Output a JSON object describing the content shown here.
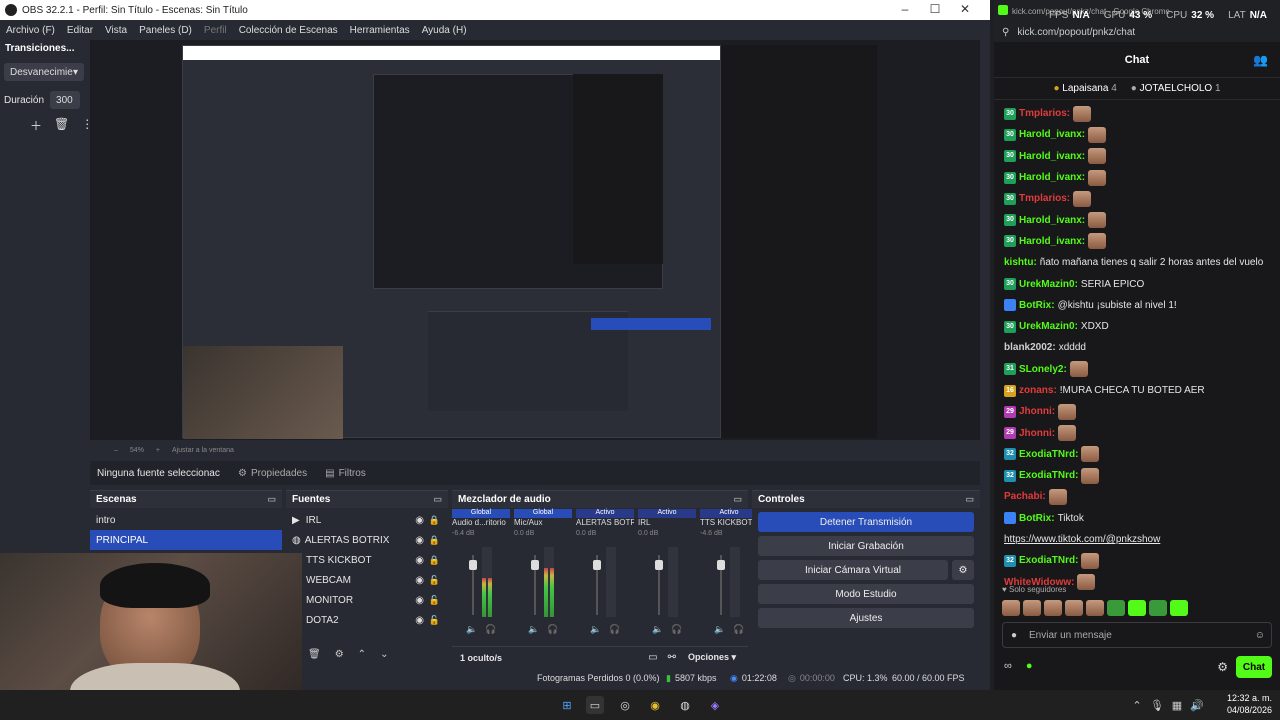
{
  "obs": {
    "title": "OBS 32.2.1 - Perfil: Sin Título - Escenas: Sin Título",
    "menu": [
      "Archivo (F)",
      "Editar",
      "Vista",
      "Paneles (D)",
      "Perfil",
      "Colección de Escenas",
      "Herramientas",
      "Ayuda (H)"
    ],
    "transitions": {
      "title": "Transiciones...",
      "type": "Desvanecimie",
      "duration_label": "Duración",
      "duration_value": "300"
    },
    "zoom": "54%",
    "fit_label": "Ajustar a la ventana",
    "source_selected": "Ninguna fuente seleccionac",
    "properties_label": "Propiedades",
    "filters_label": "Filtros",
    "scenes": {
      "title": "Escenas",
      "items": [
        "intro",
        "PRINCIPAL"
      ],
      "selected": "PRINCIPAL"
    },
    "sources": {
      "title": "Fuentes",
      "items": [
        "IRL",
        "ALERTAS BOTRIX",
        "TTS KICKBOT",
        "WEBCAM",
        "MONITOR",
        "DOTA2"
      ]
    },
    "mixer": {
      "title": "Mezclador de audio",
      "channels": [
        {
          "badge": "Global",
          "name": "Audio d...ritorio",
          "db": "-6.4 dB",
          "level": 0.55
        },
        {
          "badge": "Global",
          "name": "Mic/Aux",
          "db": "0.0 dB",
          "level": 0.7
        },
        {
          "badge": "Activo",
          "name": "ALERTAS BOTRIX",
          "db": "0.0 dB",
          "level": 0
        },
        {
          "badge": "Activo",
          "name": "IRL",
          "db": "0.0 dB",
          "level": 0
        },
        {
          "badge": "Activo",
          "name": "TTS KICKBOT",
          "db": "-4.6 dB",
          "level": 0
        }
      ],
      "scale": [
        "0",
        "-5",
        "-10",
        "-15",
        "-20",
        "-25",
        "-30",
        "-35",
        "-40",
        "-45",
        "-50",
        "-54"
      ],
      "hidden": "1 oculto/s",
      "options_label": "Opciones"
    },
    "controls": {
      "title": "Controles",
      "buttons": [
        "Detener Transmisión",
        "Iniciar Grabación",
        "Iniciar Cámara Virtual",
        "Modo Estudio",
        "Ajustes"
      ]
    },
    "status": {
      "dropped": "Fotogramas Perdidos 0 (0.0%)",
      "bitrate": "5807 kbps",
      "live_time": "01:22:08",
      "rec_time": "00:00:00",
      "cpu": "CPU: 1.3%",
      "fps": "60.00 / 60.00 FPS"
    }
  },
  "chrome": {
    "title": "kick.com/popout/pnkz/chat - Google Chrome",
    "url": "kick.com/popout/pnkz/chat",
    "perf": {
      "fps_label": "FPS",
      "fps": "N/A",
      "gpu_label": "GPU",
      "gpu": "43 %",
      "cpu_label": "CPU",
      "cpu": "32 %",
      "lat_label": "LAT",
      "lat": "N/A"
    },
    "chat_title": "Chat",
    "leaderboard": [
      {
        "name": "Lapaisana",
        "count": "4"
      },
      {
        "name": "JOTAELCHOLO",
        "count": "1"
      }
    ],
    "messages": [
      {
        "badge": "30",
        "badge_color": "#1fa05a",
        "user": "Tmplarios:",
        "color": "#e23b3b",
        "text": "",
        "emote": true
      },
      {
        "badge": "30",
        "badge_color": "#1fa05a",
        "user": "Harold_ivanx:",
        "color": "#53fc18",
        "text": "",
        "emote": true
      },
      {
        "badge": "30",
        "badge_color": "#1fa05a",
        "user": "Harold_ivanx:",
        "color": "#53fc18",
        "text": "",
        "emote": true
      },
      {
        "badge": "30",
        "badge_color": "#1fa05a",
        "user": "Harold_ivanx:",
        "color": "#53fc18",
        "text": "",
        "emote": true
      },
      {
        "badge": "30",
        "badge_color": "#1fa05a",
        "user": "Tmplarios:",
        "color": "#e23b3b",
        "text": "",
        "emote": true
      },
      {
        "badge": "30",
        "badge_color": "#1fa05a",
        "user": "Harold_ivanx:",
        "color": "#53fc18",
        "text": "",
        "emote": true
      },
      {
        "badge": "30",
        "badge_color": "#1fa05a",
        "user": "Harold_ivanx:",
        "color": "#53fc18",
        "text": "",
        "emote": true
      },
      {
        "badge": "",
        "badge_color": "",
        "user": "kishtu:",
        "color": "#53fc18",
        "text": "ñato mañana tienes q salir 2 horas antes del vuelo",
        "emote": false
      },
      {
        "badge": "30",
        "badge_color": "#1fa05a",
        "user": "UrekMazin0:",
        "color": "#53fc18",
        "text": "SERIA EPICO",
        "emote": false
      },
      {
        "badge": "",
        "badge_color": "#3b82f6",
        "user": "BotRix:",
        "color": "#53fc18",
        "text": "@kishtu ¡subiste al nivel 1!",
        "emote": false
      },
      {
        "badge": "30",
        "badge_color": "#1fa05a",
        "user": "UrekMazin0:",
        "color": "#53fc18",
        "text": "XDXD",
        "emote": false
      },
      {
        "badge": "",
        "badge_color": "",
        "user": "blank2002:",
        "color": "#cfcfcf",
        "text": "xdddd",
        "emote": false
      },
      {
        "badge": "31",
        "badge_color": "#1fa05a",
        "user": "SLonely2:",
        "color": "#53fc18",
        "text": "",
        "emote": true
      },
      {
        "badge": "16",
        "badge_color": "#d6a21f",
        "user": "zonans:",
        "color": "#e23b3b",
        "text": "!MURA CHECA TU BOTED AER",
        "emote": false
      },
      {
        "badge": "29",
        "badge_color": "#b13bb1",
        "user": "Jhonni:",
        "color": "#e23b3b",
        "text": "",
        "emote": true
      },
      {
        "badge": "29",
        "badge_color": "#b13bb1",
        "user": "Jhonni:",
        "color": "#e23b3b",
        "text": "",
        "emote": true
      },
      {
        "badge": "32",
        "badge_color": "#1f8fb0",
        "user": "ExodiaTNrd:",
        "color": "#53fc18",
        "text": "",
        "emote": true
      },
      {
        "badge": "32",
        "badge_color": "#1f8fb0",
        "user": "ExodiaTNrd:",
        "color": "#53fc18",
        "text": "",
        "emote": true
      },
      {
        "badge": "",
        "badge_color": "",
        "user": "Pachabi:",
        "color": "#e23b3b",
        "text": "",
        "emote": true
      },
      {
        "badge": "",
        "badge_color": "#3b82f6",
        "user": "BotRix:",
        "color": "#53fc18",
        "text": "Tiktok",
        "emote": false
      },
      {
        "badge": "",
        "badge_color": "",
        "user": "",
        "color": "#cfcfcf",
        "text": "https://www.tiktok.com/@pnkzshow",
        "emote": false
      },
      {
        "badge": "32",
        "badge_color": "#1f8fb0",
        "user": "ExodiaTNrd:",
        "color": "#53fc18",
        "text": "",
        "emote": true
      },
      {
        "badge": "",
        "badge_color": "",
        "user": "WhiteWidoww:",
        "color": "#e23b3b",
        "text": "",
        "emote": true
      }
    ],
    "followers_only": "Solo seguidores",
    "input_placeholder": "Enviar un mensaje",
    "send_label": "Chat"
  },
  "taskbar": {
    "time": "12:32 a. m.",
    "date": "04/08/2026"
  }
}
